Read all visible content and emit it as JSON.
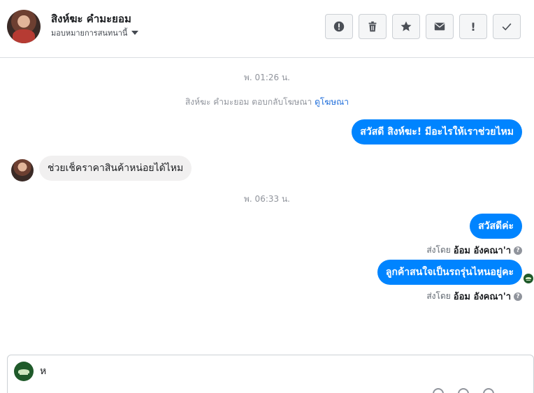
{
  "header": {
    "contact_name": "สิงห์ฆะ คำมะยอม",
    "assign_label": "มอบหมายการสนทนานี้",
    "actions": [
      {
        "name": "report-button",
        "icon": "alert-octagon-icon"
      },
      {
        "name": "delete-button",
        "icon": "trash-icon"
      },
      {
        "name": "star-button",
        "icon": "star-icon"
      },
      {
        "name": "mark-unread-button",
        "icon": "envelope-icon"
      },
      {
        "name": "important-button",
        "icon": "exclamation-icon",
        "label": "!"
      },
      {
        "name": "done-button",
        "icon": "checkmark-icon"
      }
    ]
  },
  "thread": {
    "timestamp_1": "พ. 01:26 น.",
    "ad_notice": "สิงห์ฆะ คำมะยอม ตอบกลับโฆษณา",
    "ad_link": "ดูโฆษณา",
    "msg_1": "สวัสดี สิงห์ฆะ! มีอะไรให้เราช่วยไหม",
    "msg_2": "ช่วยเช็คราคาสินค้าหน่อยได้ไหม",
    "timestamp_2": "พ. 06:33 น.",
    "msg_3": "สวัสดีค่ะ",
    "sent_by_prefix": "ส่งโดย",
    "sender_name": "อ้อม อังคณา'า",
    "msg_4": "ลูกค้าสนใจเป็นรถรุ่นไหนอยู่คะ",
    "help_glyph": "?"
  },
  "composer": {
    "value": "ห"
  },
  "colors": {
    "accent": "#0084ff",
    "link": "#216fdb",
    "incoming_bubble": "#f1f0f0"
  }
}
